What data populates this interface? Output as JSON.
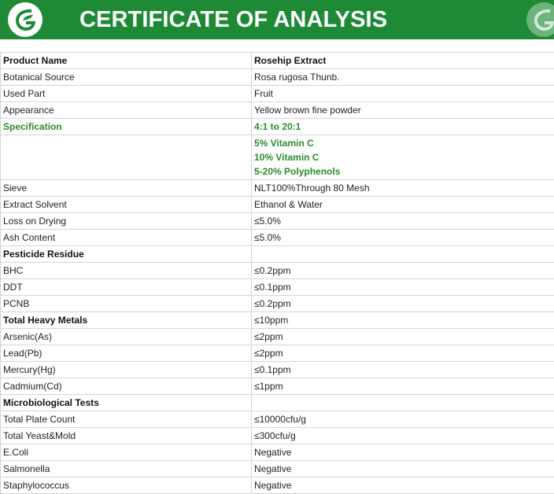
{
  "header": {
    "title": "CERTIFICATE OF ANALYSIS",
    "brand_color": "#1e8a36",
    "logo_icon": "leaf-g-logo"
  },
  "colors": {
    "header_green": "#1e8a36",
    "spec_green": "#2b8a2b",
    "grid_line": "#d4d4d4"
  },
  "table": {
    "rows": [
      {
        "label": "Product Name",
        "value": "Rosehip Extract",
        "style": "bold"
      },
      {
        "label": "Botanical Source",
        "value": "Rosa rugosa Thunb."
      },
      {
        "label": "Used Part",
        "value": "Fruit"
      },
      {
        "label": "Appearance",
        "value": "Yellow brown fine powder"
      },
      {
        "label": "Specification",
        "value": "4:1 to 20:1",
        "style": "green"
      },
      {
        "label": "",
        "values": [
          "5% Vitamin C",
          "10% Vitamin C",
          "5-20% Polyphenols"
        ],
        "style": "green"
      },
      {
        "label": "Sieve",
        "value": "NLT100%Through 80 Mesh"
      },
      {
        "label": "Extract Solvent",
        "value": "Ethanol & Water"
      },
      {
        "label": "Loss on Drying",
        "value": "≤5.0%"
      },
      {
        "label": "Ash Content",
        "value": "≤5.0%"
      },
      {
        "label": "Pesticide Residue",
        "value": "",
        "style": "bold"
      },
      {
        "label": "BHC",
        "value": "≤0.2ppm"
      },
      {
        "label": "DDT",
        "value": "≤0.1ppm"
      },
      {
        "label": "PCNB",
        "value": "≤0.2ppm"
      },
      {
        "label": "Total Heavy Metals",
        "value": "≤10ppm",
        "style": "bold-label"
      },
      {
        "label": "Arsenic(As)",
        "value": "≤2ppm"
      },
      {
        "label": "Lead(Pb)",
        "value": "≤2ppm"
      },
      {
        "label": "Mercury(Hg)",
        "value": "≤0.1ppm"
      },
      {
        "label": "Cadmium(Cd)",
        "value": "≤1ppm"
      },
      {
        "label": "Microbiological Tests",
        "value": "",
        "style": "bold"
      },
      {
        "label": "Total Plate Count",
        "value": "≤10000cfu/g"
      },
      {
        "label": "Total Yeast&Mold",
        "value": "≤300cfu/g"
      },
      {
        "label": "E.Coli",
        "value": "Negative"
      },
      {
        "label": "Salmonella",
        "value": "Negative"
      },
      {
        "label": "Staphylococcus",
        "value": "Negative"
      }
    ]
  }
}
